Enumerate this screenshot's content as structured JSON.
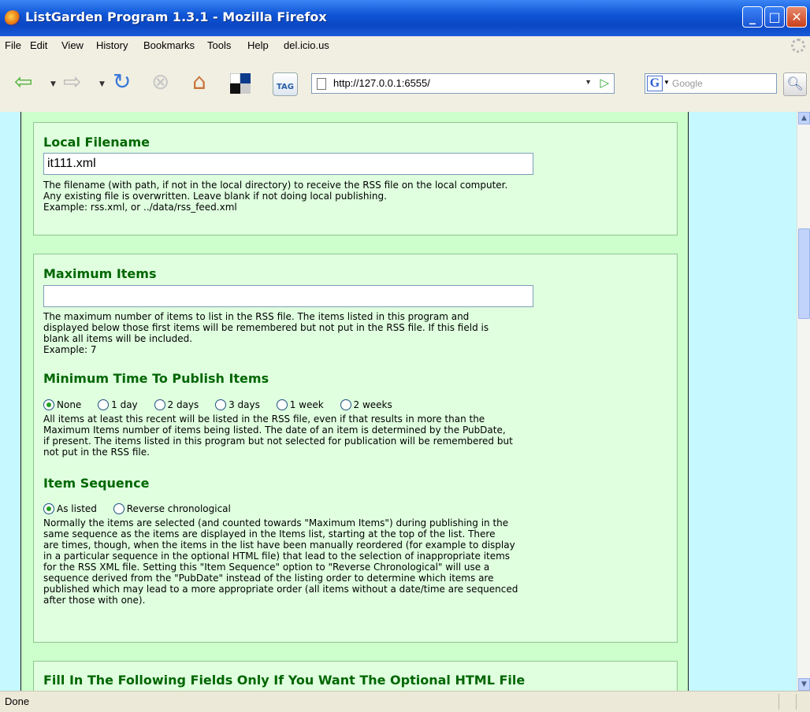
{
  "window": {
    "title": "ListGarden Program 1.3.1 - Mozilla Firefox",
    "minimize": "_",
    "maximize": "□",
    "close": "✕"
  },
  "menu": [
    "File",
    "Edit",
    "View",
    "History",
    "Bookmarks",
    "Tools",
    "Help",
    "del.icio.us"
  ],
  "toolbar": {
    "url": "http://127.0.0.1:6555/",
    "search_placeholder": "Google",
    "search_engine": "G",
    "tag_label": "TAG"
  },
  "sections": {
    "local_filename": {
      "heading": "Local Filename",
      "value": "it111.xml",
      "desc1": "The filename (with path, if not in the local directory) to receive the RSS file on the local computer.",
      "desc2": "Any existing file is overwritten. Leave blank if not doing local publishing.",
      "desc3": "Example: rss.xml, or ../data/rss_feed.xml"
    },
    "max_items": {
      "heading": "Maximum Items",
      "value": "",
      "desc1": "The maximum number of items to list in the RSS file. The items listed in this program and",
      "desc2": "displayed below those first items will be remembered but not put in the RSS file. If this field is",
      "desc3": "blank all items will be included.",
      "desc4": "Example: 7"
    },
    "min_time": {
      "heading": "Minimum Time To Publish Items",
      "options": [
        "None",
        "1 day",
        "2 days",
        "3 days",
        "1 week",
        "2 weeks"
      ],
      "selected": "None",
      "desc1": "All items at least this recent will be listed in the RSS file, even if that results in more than the",
      "desc2": "Maximum Items number of items being listed. The date of an item is determined by the PubDate,",
      "desc3": "if present. The items listed in this program but not selected for publication will be remembered but",
      "desc4": "not put in the RSS file."
    },
    "item_sequence": {
      "heading": "Item Sequence",
      "options": [
        "As listed",
        "Reverse chronological"
      ],
      "selected": "As listed",
      "desc1": "Normally the items are selected (and counted towards \"Maximum Items\") during publishing in the",
      "desc2": "same sequence as the items are displayed in the Items list, starting at the top of the list. There",
      "desc3": "are times, though, when the items in the list have been manually reordered (for example to display",
      "desc4": "in a particular sequence in the optional HTML file) that lead to the selection of inappropriate items",
      "desc5": "for the RSS XML file. Setting this \"Item Sequence\" option to \"Reverse Chronological\" will use a",
      "desc6": "sequence derived from the \"PubDate\" instead of the listing order to determine which items are",
      "desc7": "published which may lead to a more appropriate order (all items without a date/time are sequenced",
      "desc8": "after those with one)."
    },
    "html_file": {
      "heading": "Fill In The Following Fields Only If You Want The Optional HTML File"
    }
  },
  "status": {
    "text": "Done"
  }
}
